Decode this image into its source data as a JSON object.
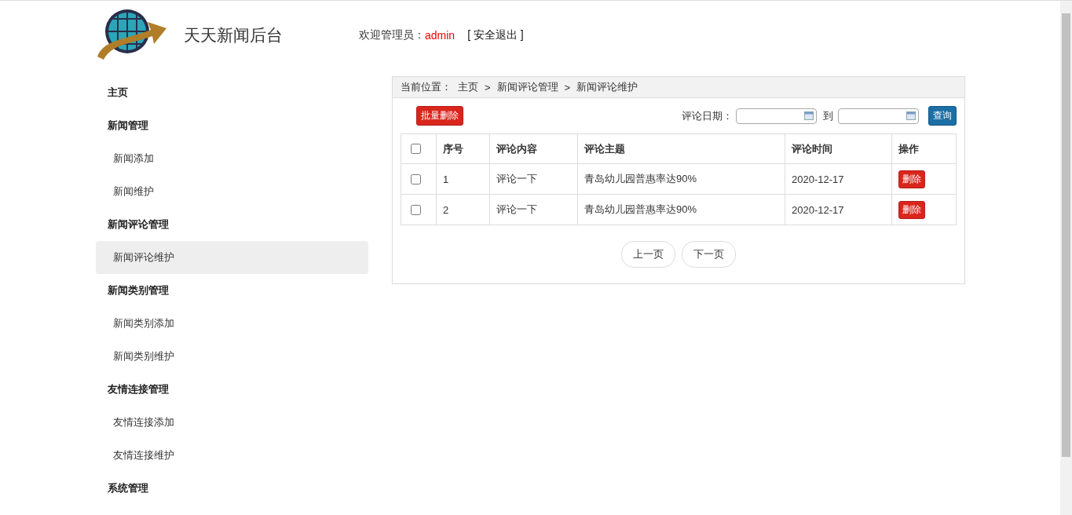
{
  "header": {
    "title": "天天新闻后台",
    "welcome_label": "欢迎管理员：",
    "username": "admin",
    "logout": "[ 安全退出 ]"
  },
  "sidebar": {
    "groups": [
      {
        "label": "主页",
        "selected": false
      },
      {
        "label": "新闻管理",
        "selected": false,
        "children": [
          {
            "label": "新闻添加",
            "selected": false
          },
          {
            "label": "新闻维护",
            "selected": false
          }
        ]
      },
      {
        "label": "新闻评论管理",
        "selected": false,
        "children": [
          {
            "label": "新闻评论维护",
            "selected": true
          }
        ]
      },
      {
        "label": "新闻类别管理",
        "selected": false,
        "children": [
          {
            "label": "新闻类别添加",
            "selected": false
          },
          {
            "label": "新闻类别维护",
            "selected": false
          }
        ]
      },
      {
        "label": "友情连接管理",
        "selected": false,
        "children": [
          {
            "label": "友情连接添加",
            "selected": false
          },
          {
            "label": "友情连接维护",
            "selected": false
          }
        ]
      },
      {
        "label": "系统管理",
        "selected": false
      }
    ]
  },
  "breadcrumb": {
    "label": "当前位置：",
    "items": [
      "主页",
      "新闻评论管理",
      "新闻评论维护"
    ],
    "separator": ">"
  },
  "toolbar": {
    "batch_delete": "批量删除",
    "date_label": "评论日期：",
    "to_label": "到",
    "search": "查询"
  },
  "table": {
    "select_all_checked": false,
    "columns": [
      "序号",
      "评论内容",
      "评论主题",
      "评论时间",
      "操作"
    ],
    "rows": [
      {
        "checked": false,
        "cells": [
          "1",
          "评论一下",
          "青岛幼儿园普惠率达90%",
          "2020-12-17"
        ],
        "action": "删除"
      },
      {
        "checked": false,
        "cells": [
          "2",
          "评论一下",
          "青岛幼儿园普惠率达90%",
          "2020-12-17"
        ],
        "action": "删除"
      }
    ]
  },
  "pagination": {
    "prev": "上一页",
    "next": "下一页"
  }
}
